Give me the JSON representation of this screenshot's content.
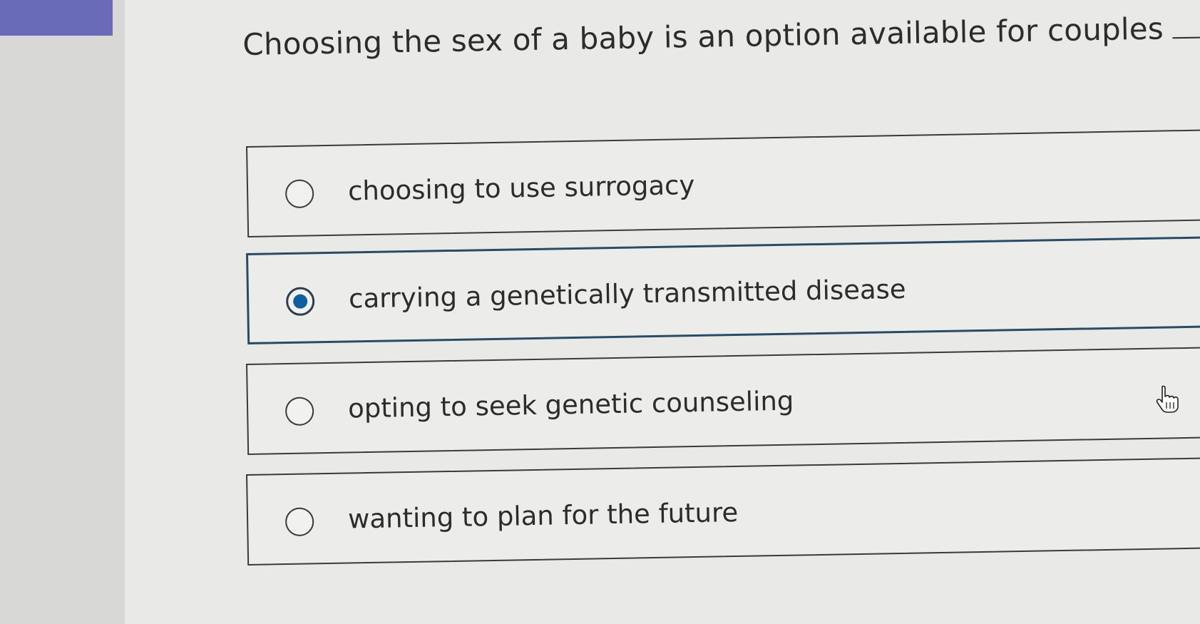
{
  "question": {
    "text": "Choosing the sex of a baby is an option available for couples",
    "end": "."
  },
  "options": [
    {
      "label": "choosing to use surrogacy",
      "selected": false
    },
    {
      "label": "carrying a genetically transmitted disease",
      "selected": true
    },
    {
      "label": "opting to seek genetic counseling",
      "selected": false
    },
    {
      "label": "wanting to plan for the future",
      "selected": false
    }
  ],
  "colors": {
    "accent": "#6a6bb8",
    "selected_dot": "#0f5fa0",
    "selected_border": "#2a4a66"
  },
  "icons": {
    "cursor": "hand-pointer-icon"
  }
}
